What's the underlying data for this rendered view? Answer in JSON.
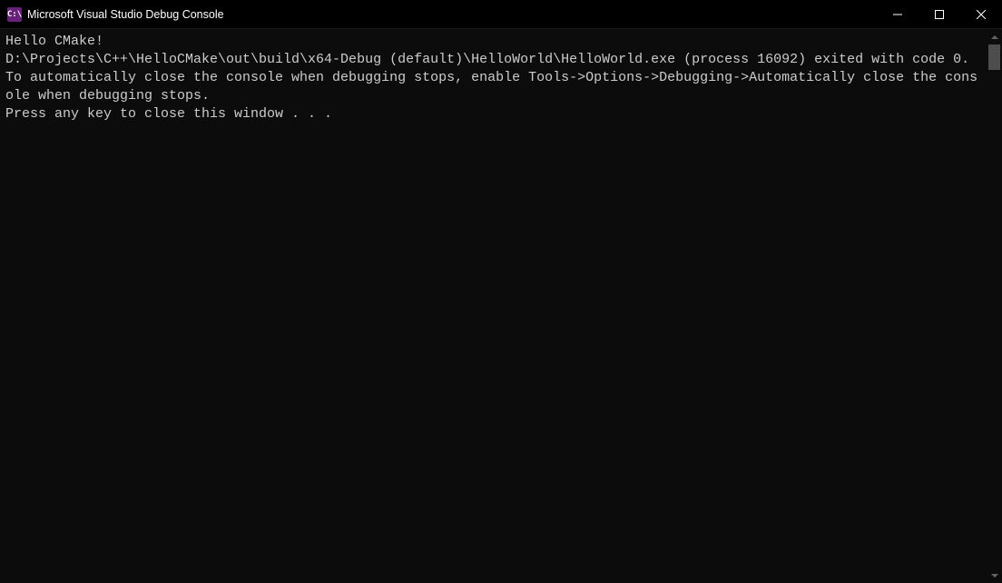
{
  "window": {
    "title": "Microsoft Visual Studio Debug Console",
    "icon_label": "C:\\"
  },
  "console": {
    "lines": {
      "l0": "Hello CMake!",
      "l1": "",
      "l2": "D:\\Projects\\C++\\HelloCMake\\out\\build\\x64-Debug (default)\\HelloWorld\\HelloWorld.exe (process 16092) exited with code 0.",
      "l3": "To automatically close the console when debugging stops, enable Tools->Options->Debugging->Automatically close the console when debugging stops.",
      "l4": "Press any key to close this window . . ."
    }
  }
}
